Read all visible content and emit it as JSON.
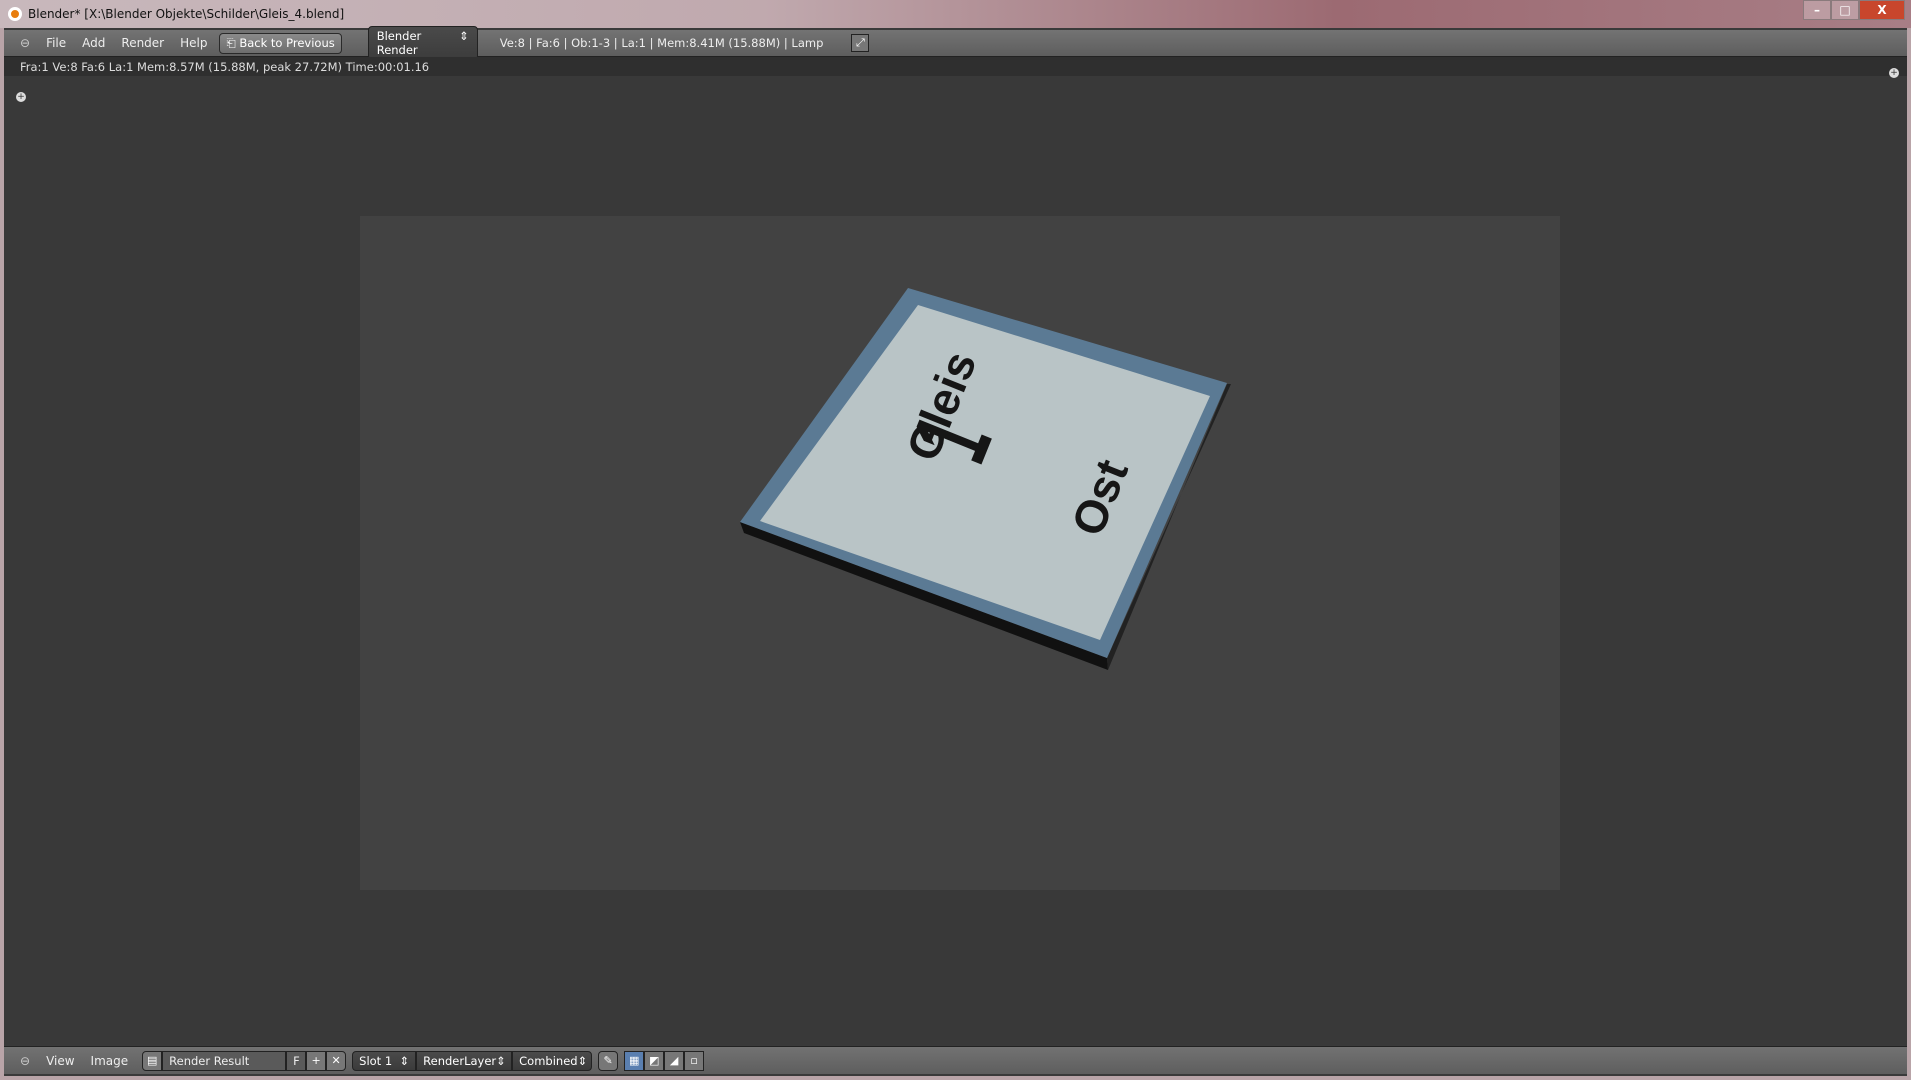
{
  "window": {
    "title": "Blender* [X:\\Blender Objekte\\Schilder\\Gleis_4.blend]",
    "minimize": "–",
    "maximize": "□",
    "close": "X"
  },
  "header": {
    "menus": [
      "File",
      "Add",
      "Render",
      "Help"
    ],
    "back_button": "Back to Previous",
    "engine": "Blender Render",
    "stats": "Ve:8 | Fa:6 | Ob:1-3 | La:1 | Mem:8.41M (15.88M) | Lamp"
  },
  "info": "Fra:1  Ve:8 Fa:6 La:1 Mem:8.57M (15.88M, peak 27.72M) Time:00:01.16",
  "render": {
    "sign_text": [
      "Gleis",
      "1",
      "Ost"
    ],
    "colors": {
      "frame": "#5b7a94",
      "face": "#b9c4c6",
      "bg": "#424242"
    }
  },
  "footer": {
    "menus": [
      "View",
      "Image"
    ],
    "image_name": "Render Result",
    "fake_user": "F",
    "slot": "Slot 1",
    "layer": "RenderLayer",
    "pass": "Combined"
  }
}
